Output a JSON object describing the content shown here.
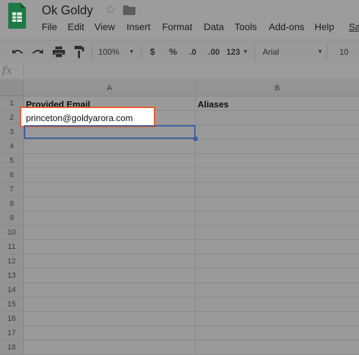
{
  "app": {
    "doc_title": "Ok Goldy",
    "menu": [
      "File",
      "Edit",
      "View",
      "Insert",
      "Format",
      "Data",
      "Tools",
      "Add-ons",
      "Help",
      "Sa"
    ]
  },
  "toolbar": {
    "zoom": "100%",
    "currency": "$",
    "percent": "%",
    "decrease_decimal": ".0",
    "increase_decimal": ".00",
    "more_formats": "123",
    "font": "Arial",
    "font_size": "10"
  },
  "formula_bar": {
    "fx_label": "fx",
    "value": ""
  },
  "grid": {
    "columns": [
      "A",
      "B"
    ],
    "rows": [
      "1",
      "2",
      "3",
      "4",
      "5",
      "6",
      "7",
      "8",
      "9",
      "10",
      "11",
      "12",
      "13",
      "14",
      "15",
      "16",
      "17",
      "18"
    ],
    "cells": {
      "A1": "Provided Email",
      "B1": "Aliases",
      "A2": "princeton@goldyarora.com"
    }
  },
  "colors": {
    "overlay_gray": "#9a9a9a",
    "highlight_border": "#ee5a2c",
    "selection_blue": "#3d5fa3",
    "sheets_green": "#0f9d58"
  }
}
